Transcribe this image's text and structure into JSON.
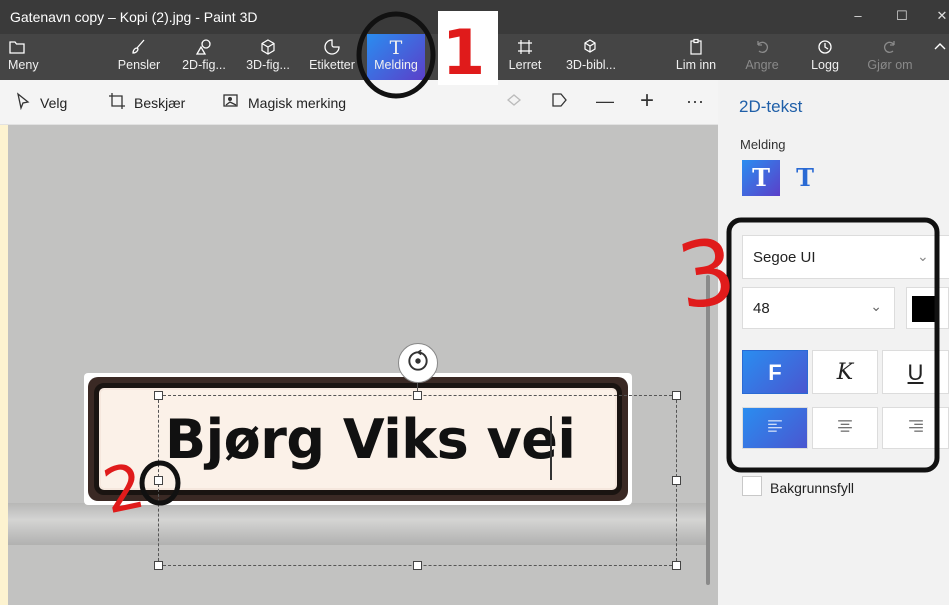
{
  "window": {
    "title": "Gatenavn copy – Kopi (2).jpg - Paint 3D",
    "controls": [
      "–",
      "☐",
      "✕"
    ]
  },
  "ribbon": {
    "items": [
      {
        "label": "Meny",
        "icon": "folder-icon"
      },
      {
        "label": "Pensler",
        "icon": "brush-icon"
      },
      {
        "label": "2D-fig...",
        "icon": "2d-shapes-icon"
      },
      {
        "label": "3D-fig...",
        "icon": "3d-shapes-icon"
      },
      {
        "label": "Etiketter",
        "icon": "stickers-icon"
      },
      {
        "label": "Melding",
        "icon": "text-icon",
        "active": true
      },
      {
        "label": "Lerret",
        "icon": "canvas-icon"
      },
      {
        "label": "3D-bibl...",
        "icon": "3d-library-icon"
      },
      {
        "label": "Lim inn",
        "icon": "paste-icon"
      },
      {
        "label": "Angre",
        "icon": "undo-icon",
        "disabled": true
      },
      {
        "label": "Logg",
        "icon": "history-icon"
      },
      {
        "label": "Gjør om",
        "icon": "redo-icon",
        "disabled": true
      }
    ],
    "icon_glyphs": {
      "text": "T"
    }
  },
  "toolbar": {
    "select": "Velg",
    "crop": "Beskjær",
    "magic_select": "Magisk merking",
    "more": "···",
    "minus": "—",
    "plus": "+"
  },
  "canvas": {
    "sign_text": "Bjørg Viks vei"
  },
  "panel": {
    "title": "2D-tekst",
    "label": "Melding",
    "tool_plain": "T",
    "tool_3d": "T",
    "font": "Segoe UI",
    "size": "48",
    "size_chevron": "⌄",
    "font_chevron": "⌄",
    "text_color": "#000000",
    "bold": "F",
    "italic": "K",
    "underline": "U",
    "background_fill": "Bakgrunnsfyll"
  },
  "annotations": {
    "n1": "1",
    "n2": "2",
    "n3": "3",
    "ink_color": "#e01b1b"
  }
}
